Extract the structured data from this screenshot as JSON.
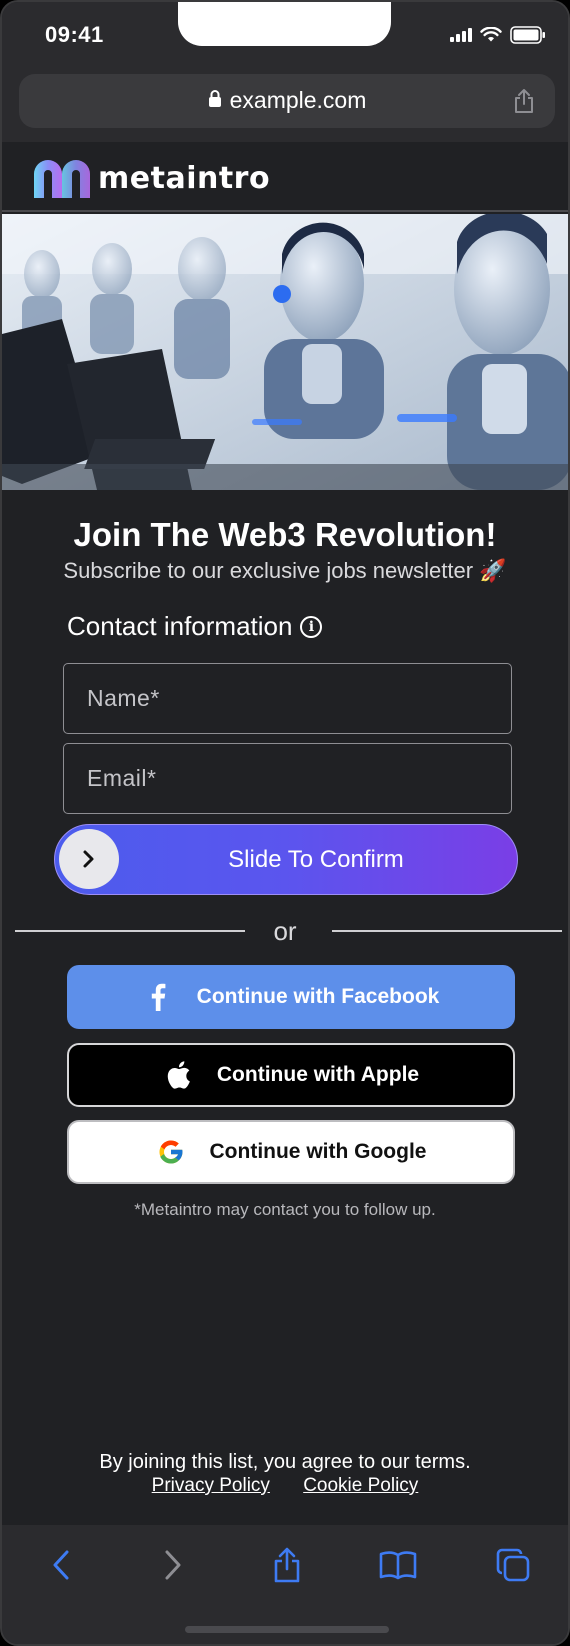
{
  "status_bar": {
    "time": "09:41"
  },
  "browser": {
    "url": "example.com"
  },
  "site": {
    "logo_text": "metaintro"
  },
  "hero": {
    "alt": "Robots working at computers"
  },
  "signup": {
    "title": "Join The Web3 Revolution!",
    "subtitle": "Subscribe to our exclusive jobs newsletter 🚀",
    "contact_label": "Contact information",
    "name_placeholder": "Name*",
    "email_placeholder": "Email*",
    "slide_label": "Slide To Confirm",
    "or_text": "or",
    "facebook_label": "Continue with Facebook",
    "apple_label": "Continue with Apple",
    "google_label": "Continue with Google",
    "followup_note": "*Metaintro may contact you to follow up."
  },
  "footer": {
    "terms": "By joining this list, you agree to our terms.",
    "privacy": "Privacy Policy",
    "cookie": "Cookie Policy"
  },
  "colors": {
    "page_bg": "#202124",
    "accent_gradient_start": "#4c5ced",
    "accent_gradient_end": "#7a3ee6",
    "facebook_blue": "#5d8fea",
    "safari_blue": "#3e7bf3"
  },
  "icons": [
    "lock-icon",
    "share-icon",
    "info-icon",
    "chevron-right-icon",
    "facebook-icon",
    "apple-icon",
    "google-icon",
    "back-icon",
    "forward-icon",
    "bookmarks-icon",
    "tabs-icon"
  ]
}
